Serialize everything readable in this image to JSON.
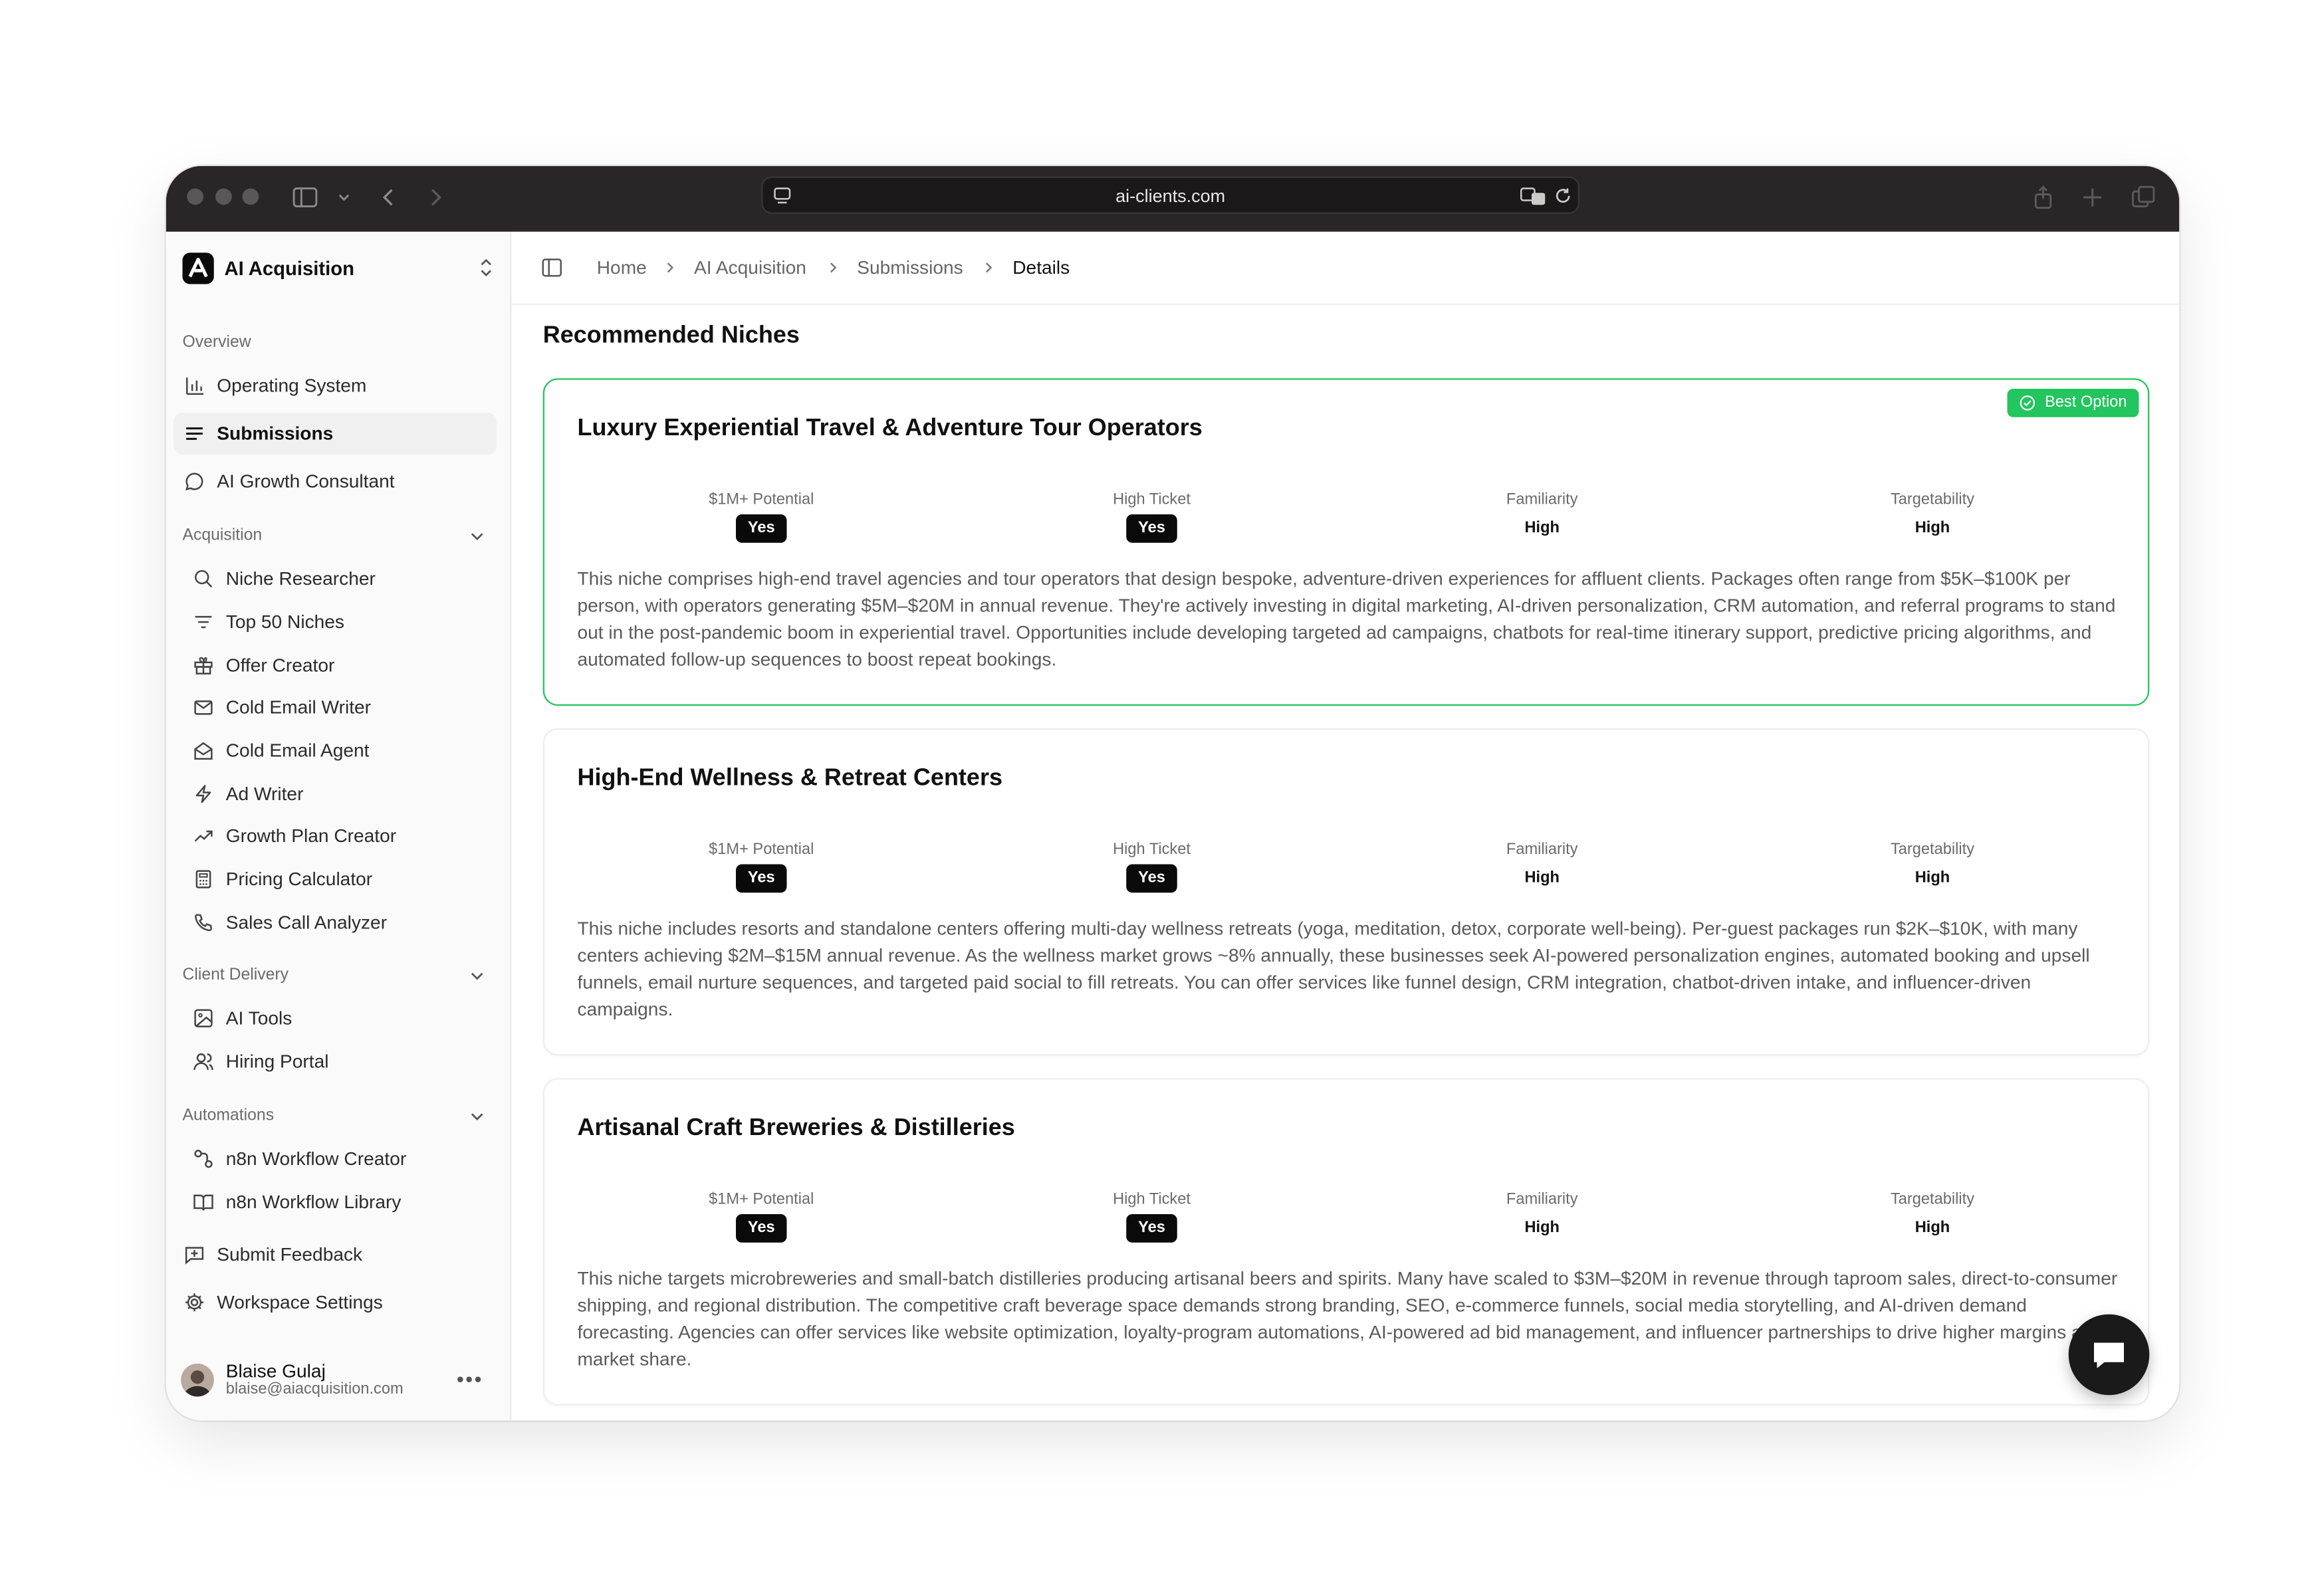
{
  "browser": {
    "url": "ai-clients.com"
  },
  "sidebar": {
    "workspace": "AI Acquisition",
    "overview_label": "Overview",
    "overview_items": [
      {
        "label": "Operating System",
        "icon": "bar-chart-icon"
      },
      {
        "label": "Submissions",
        "icon": "list-icon",
        "active": true
      },
      {
        "label": "AI Growth Consultant",
        "icon": "message-circle-icon"
      }
    ],
    "acquisition_label": "Acquisition",
    "acquisition_items": [
      {
        "label": "Niche Researcher",
        "icon": "search-icon"
      },
      {
        "label": "Top 50 Niches",
        "icon": "filter-icon"
      },
      {
        "label": "Offer Creator",
        "icon": "gift-icon"
      },
      {
        "label": "Cold Email Writer",
        "icon": "mail-icon"
      },
      {
        "label": "Cold Email Agent",
        "icon": "mail-open-icon"
      },
      {
        "label": "Ad Writer",
        "icon": "zap-icon"
      },
      {
        "label": "Growth Plan Creator",
        "icon": "trending-up-icon"
      },
      {
        "label": "Pricing Calculator",
        "icon": "calculator-icon"
      },
      {
        "label": "Sales Call Analyzer",
        "icon": "phone-icon"
      }
    ],
    "delivery_label": "Client Delivery",
    "delivery_items": [
      {
        "label": "AI Tools",
        "icon": "image-icon"
      },
      {
        "label": "Hiring Portal",
        "icon": "users-icon"
      }
    ],
    "automations_label": "Automations",
    "automations_items": [
      {
        "label": "n8n Workflow Creator",
        "icon": "workflow-icon"
      },
      {
        "label": "n8n Workflow Library",
        "icon": "book-open-icon"
      }
    ],
    "footer_items": [
      {
        "label": "Submit Feedback",
        "icon": "message-square-plus-icon"
      },
      {
        "label": "Workspace Settings",
        "icon": "gear-icon"
      }
    ],
    "user": {
      "name": "Blaise Gulaj",
      "email": "blaise@aiacquisition.com"
    }
  },
  "breadcrumbs": [
    "Home",
    "AI Acquisition",
    "Submissions",
    "Details"
  ],
  "main": {
    "section_title": "Recommended Niches",
    "best_badge": "Best Option",
    "metric_labels": [
      "$1M+ Potential",
      "High Ticket",
      "Familiarity",
      "Targetability"
    ],
    "niches": [
      {
        "title": "Luxury Experiential Travel & Adventure Tour Operators",
        "values": [
          "Yes",
          "Yes",
          "High",
          "High"
        ],
        "description": "This niche comprises high-end travel agencies and tour operators that design bespoke, adventure-driven experiences for affluent clients. Packages often range from $5K–$100K per person, with operators generating $5M–$20M in annual revenue. They're actively investing in digital marketing, AI-driven personalization, CRM automation, and referral programs to stand out in the post-pandemic boom in experiential travel. Opportunities include developing targeted ad campaigns, chatbots for real-time itinerary support, predictive pricing algorithms, and automated follow-up sequences to boost repeat bookings."
      },
      {
        "title": "High-End Wellness & Retreat Centers",
        "values": [
          "Yes",
          "Yes",
          "High",
          "High"
        ],
        "description": "This niche includes resorts and standalone centers offering multi-day wellness retreats (yoga, meditation, detox, corporate well-being). Per-guest packages run $2K–$10K, with many centers achieving $2M–$15M annual revenue. As the wellness market grows ~8% annually, these businesses seek AI-powered personalization engines, automated booking and upsell funnels, email nurture sequences, and targeted paid social to fill retreats. You can offer services like funnel design, CRM integration, chatbot-driven intake, and influencer-driven campaigns."
      },
      {
        "title": "Artisanal Craft Breweries & Distilleries",
        "values": [
          "Yes",
          "Yes",
          "High",
          "High"
        ],
        "description": "This niche targets microbreweries and small-batch distilleries producing artisanal beers and spirits. Many have scaled to $3M–$20M in revenue through taproom sales, direct-to-consumer shipping, and regional distribution. The competitive craft beverage space demands strong branding, SEO, e-commerce funnels, social media storytelling, and AI-driven demand forecasting. Agencies can offer services like website optimization, loyalty-program automations, AI-powered ad bid management, and influencer partnerships to drive higher margins and market share."
      }
    ]
  },
  "colors": {
    "accent_green": "#22c55e",
    "chrome": "#2a2527",
    "dark_pill": "#0a0a0a"
  }
}
